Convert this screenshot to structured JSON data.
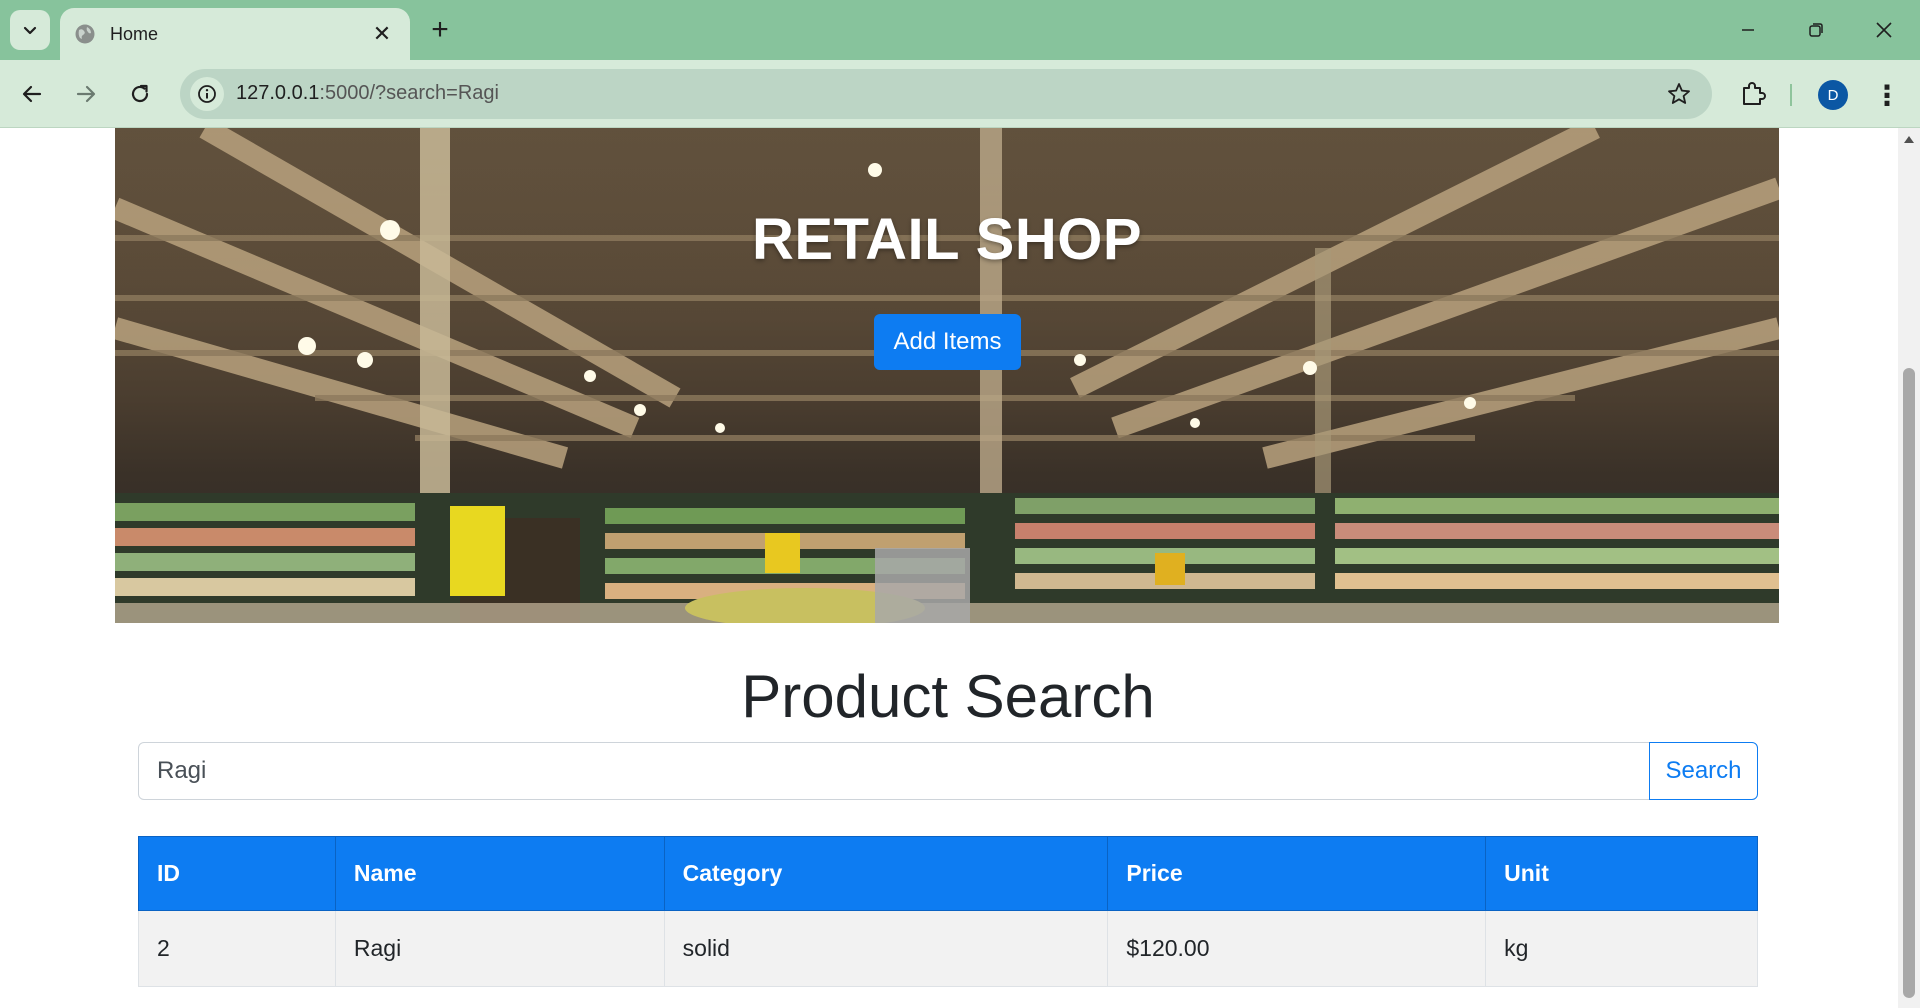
{
  "browser": {
    "tab_title": "Home",
    "url_host": "127.0.0.1",
    "url_rest": ":5000/?search=Ragi",
    "profile_initial": "D"
  },
  "hero": {
    "title": "RETAIL SHOP",
    "add_button": "Add Items"
  },
  "search": {
    "heading": "Product Search",
    "query": "Ragi",
    "button": "Search"
  },
  "table": {
    "headers": [
      "ID",
      "Name",
      "Category",
      "Price",
      "Unit"
    ],
    "rows": [
      [
        "2",
        "Ragi",
        "solid",
        "$120.00",
        "kg"
      ]
    ]
  },
  "colors": {
    "primary": "#0d7cf2",
    "chrome_tabbar": "#87c39c",
    "chrome_toolbar": "#d6ead9"
  }
}
